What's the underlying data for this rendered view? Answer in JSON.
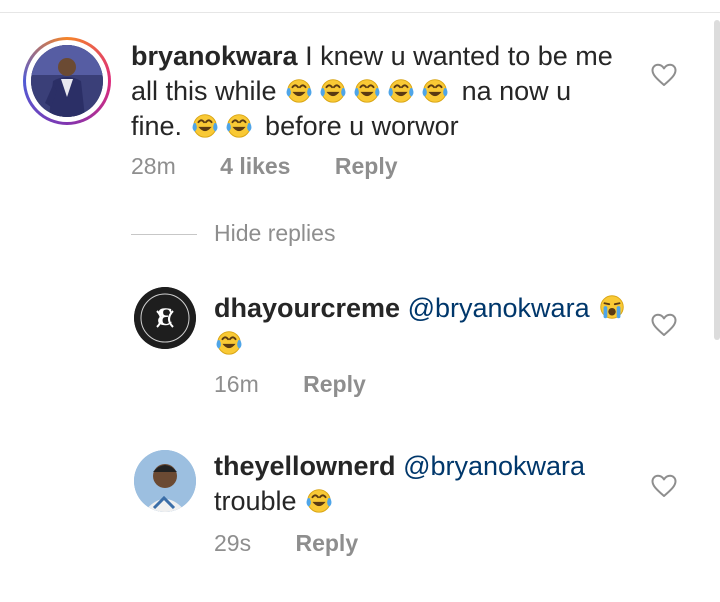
{
  "comments": [
    {
      "username": "bryanokwara",
      "segments": [
        {
          "type": "text",
          "value": " I knew u wanted to be me "
        },
        {
          "type": "text",
          "value": "all this while "
        },
        {
          "type": "emoji",
          "value": "joy"
        },
        {
          "type": "emoji",
          "value": "joy"
        },
        {
          "type": "emoji",
          "value": "joy"
        },
        {
          "type": "emoji",
          "value": "joy"
        },
        {
          "type": "emoji",
          "value": "joy"
        },
        {
          "type": "text",
          "value": " na now u "
        },
        {
          "type": "text",
          "value": "fine. "
        },
        {
          "type": "emoji",
          "value": "joy"
        },
        {
          "type": "emoji",
          "value": "joy"
        },
        {
          "type": "text",
          "value": " before u worwor"
        }
      ],
      "time": "28m",
      "likes": "4 likes",
      "reply": "Reply"
    },
    {
      "username": "dhayourcreme",
      "mention": "@bryanokwara",
      "time": "16m",
      "reply": "Reply",
      "avatar_text": "CREME DE LA CREME"
    },
    {
      "username": "theyellownerd",
      "mention": "@bryanokwara",
      "text2": "trouble",
      "time": "29s",
      "reply": "Reply"
    }
  ],
  "hide_replies": "Hide replies",
  "icons": {
    "heart": "heart-outline-icon",
    "laugh": "face-with-tears-of-joy",
    "cry": "loudly-crying-face"
  },
  "colors": {
    "text": "#262626",
    "muted": "#8e8e8e",
    "mention": "#00376b",
    "emoji_yellow": "#f9c935",
    "emoji_tears": "#4fa5e8"
  }
}
